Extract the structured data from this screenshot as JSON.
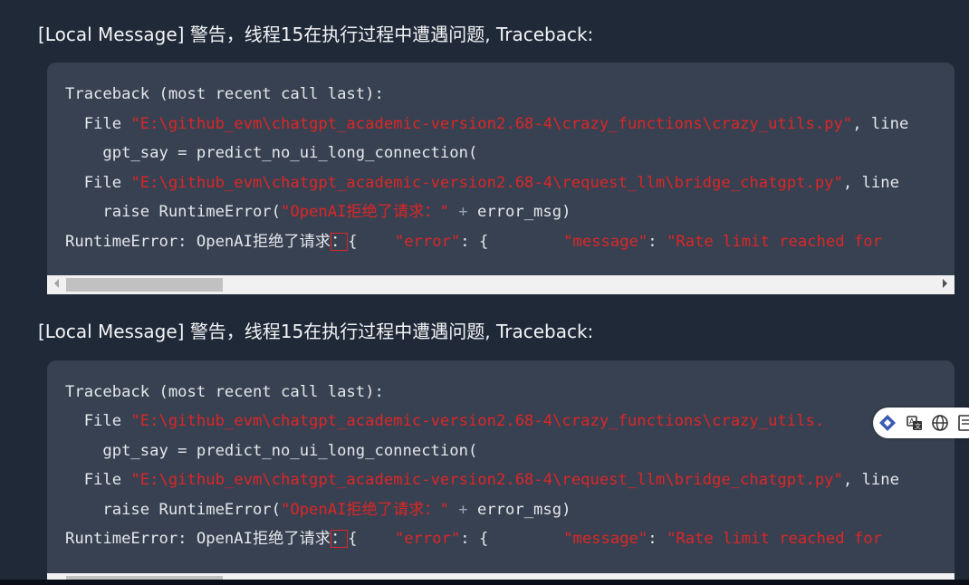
{
  "messages": [
    {
      "heading": "[Local Message] 警告，线程15在执行过程中遭遇问题, Traceback:",
      "code": {
        "l1": "Traceback (most recent call last):",
        "l2_pre": "  File ",
        "l2_str": "\"E:\\github_evm\\chatgpt_academic-version2.68-4\\crazy_functions\\crazy_utils.py\"",
        "l2_post": ", line",
        "l3": "    gpt_say = predict_no_ui_long_connection(",
        "l4_pre": "  File ",
        "l4_str": "\"E:\\github_evm\\chatgpt_academic-version2.68-4\\request_llm\\bridge_chatgpt.py\"",
        "l4_post": ", line",
        "l5_pre": "    raise RuntimeError(",
        "l5_str": "\"OpenAI拒绝了请求：\"",
        "l5_op": " + ",
        "l5_post": "error_msg)",
        "l6_pre": "RuntimeError: OpenAI拒绝了请求",
        "l6_box": "：",
        "l6_a": "{    ",
        "l6_b": "\"error\"",
        "l6_c": ": {        ",
        "l6_d": "\"message\"",
        "l6_e": ": ",
        "l6_f": "\"Rate limit reached for"
      }
    },
    {
      "heading": "[Local Message] 警告，线程15在执行过程中遭遇问题, Traceback:",
      "code": {
        "l1": "Traceback (most recent call last):",
        "l2_pre": "  File ",
        "l2_str": "\"E:\\github_evm\\chatgpt_academic-version2.68-4\\crazy_functions\\crazy_utils.",
        "l2_post": "",
        "l3": "    gpt_say = predict_no_ui_long_connection(",
        "l4_pre": "  File ",
        "l4_str": "\"E:\\github_evm\\chatgpt_academic-version2.68-4\\request_llm\\bridge_chatgpt.py\"",
        "l4_post": ", line",
        "l5_pre": "    raise RuntimeError(",
        "l5_str": "\"OpenAI拒绝了请求：\"",
        "l5_op": " + ",
        "l5_post": "error_msg)",
        "l6_pre": "RuntimeError: OpenAI拒绝了请求",
        "l6_box": "：",
        "l6_a": "{    ",
        "l6_b": "\"error\"",
        "l6_c": ": {        ",
        "l6_d": "\"message\"",
        "l6_e": ": ",
        "l6_f": "\"Rate limit reached for"
      }
    }
  ],
  "toolbar": {
    "icons": [
      "diamond-logo-icon",
      "translate-icon",
      "globe-icon",
      "document-icon"
    ]
  },
  "colors": {
    "panel_bg": "#1f2937",
    "code_bg": "#374151",
    "string": "#dc2626",
    "text": "#e5e7eb"
  }
}
